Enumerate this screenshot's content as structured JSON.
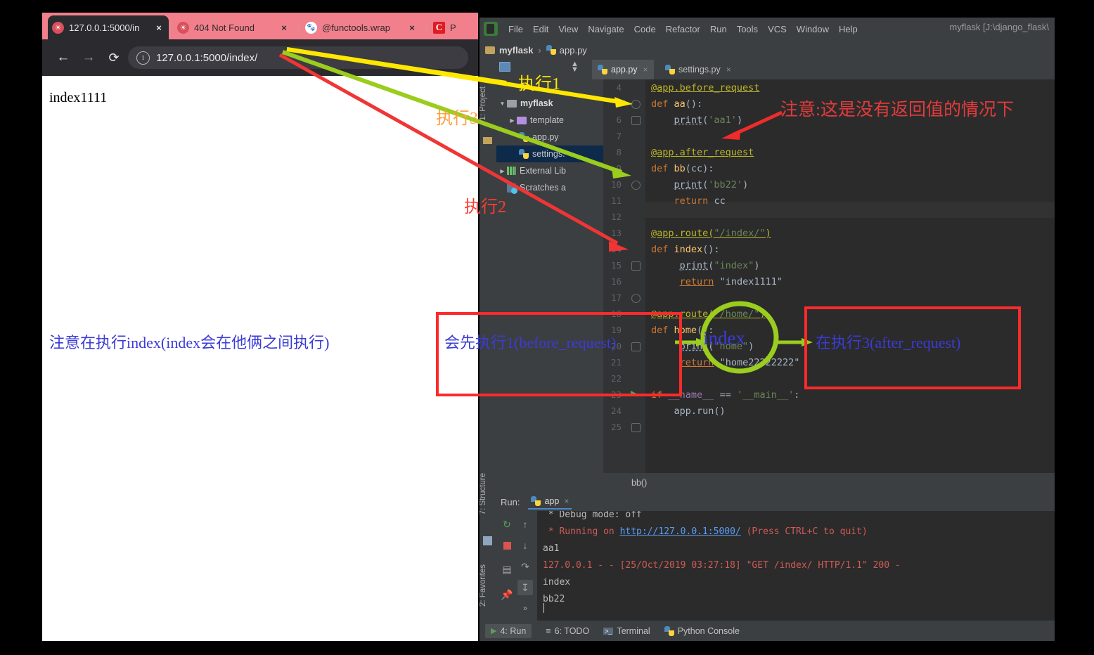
{
  "browser": {
    "tabs": [
      {
        "title": "127.0.0.1:5000/in",
        "favicon": "globe-icon",
        "active": true
      },
      {
        "title": "404 Not Found",
        "favicon": "globe-icon",
        "active": false
      },
      {
        "title": "@functools.wrap",
        "favicon": "baidu-icon",
        "active": false
      },
      {
        "title": "P",
        "favicon": "c-icon",
        "active": false
      }
    ],
    "close_label": "×",
    "nav": {
      "back": "←",
      "forward": "→",
      "reload": "⟳",
      "info": "i"
    },
    "url": "127.0.0.1:5000/index/",
    "page_text": "index1111"
  },
  "pycharm": {
    "menu": [
      "File",
      "Edit",
      "View",
      "Navigate",
      "Code",
      "Refactor",
      "Run",
      "Tools",
      "VCS",
      "Window",
      "Help"
    ],
    "window_title": "myflask [J:\\django_flask\\",
    "breadcrumb": {
      "project": "myflask",
      "separator": "›",
      "file": "app.py"
    },
    "toolwindows_left": [
      "1: Project",
      "7: Structure",
      "2: Favorites"
    ],
    "project": {
      "header": "Project",
      "tree": [
        {
          "label": "myflask",
          "type": "folder-root",
          "expanded": true,
          "indent": 0
        },
        {
          "label": "template",
          "type": "folder",
          "expanded": false,
          "indent": 1
        },
        {
          "label": "app.py",
          "type": "python",
          "indent": 1
        },
        {
          "label": "settings.",
          "type": "python",
          "indent": 1,
          "selected": true
        },
        {
          "label": "External Lib",
          "type": "library",
          "expanded": false,
          "indent": 0
        },
        {
          "label": "Scratches a",
          "type": "scratches",
          "indent": 0
        }
      ]
    },
    "editor_tabs": [
      {
        "label": "app.py",
        "active": true,
        "close": "×"
      },
      {
        "label": "settings.py",
        "active": false,
        "close": "×"
      }
    ],
    "code": {
      "first_line_number": 4,
      "lines": [
        {
          "n": 4,
          "text": "@app.before_request"
        },
        {
          "n": 5,
          "text": "def aa():"
        },
        {
          "n": 6,
          "text": "    print('aa1')"
        },
        {
          "n": 7,
          "text": ""
        },
        {
          "n": 8,
          "text": "@app.after_request"
        },
        {
          "n": 9,
          "text": "def bb(cc):"
        },
        {
          "n": 10,
          "text": "    print('bb22')"
        },
        {
          "n": 11,
          "text": "    return cc"
        },
        {
          "n": 12,
          "text": ""
        },
        {
          "n": 13,
          "text": "@app.route(\"/index/\")"
        },
        {
          "n": 14,
          "text": "def index():"
        },
        {
          "n": 15,
          "text": "    print(\"index\")"
        },
        {
          "n": 16,
          "text": "    return \"index1111\""
        },
        {
          "n": 17,
          "text": ""
        },
        {
          "n": 18,
          "text": "@app.route(\"/home/\")"
        },
        {
          "n": 19,
          "text": "def home():"
        },
        {
          "n": 20,
          "text": "    print(\"home\")"
        },
        {
          "n": 21,
          "text": "    return \"home22222222\""
        },
        {
          "n": 22,
          "text": ""
        },
        {
          "n": 23,
          "text": "if __name__ == '__main__':"
        },
        {
          "n": 24,
          "text": "    app.run()"
        },
        {
          "n": 25,
          "text": ""
        }
      ],
      "breadcrumb_bottom": "bb()"
    },
    "run": {
      "label": "Run:",
      "tab": "app",
      "tab_close": "×",
      "toolbar_icons": [
        "rerun-icon",
        "stop-icon",
        "print-icon",
        "pin-icon",
        "scroll-up-icon",
        "scroll-down-icon",
        "soft-wrap-icon",
        "scroll-to-end-icon",
        "more-icon"
      ],
      "console": [
        {
          "text": " * Debug mode: off",
          "type": "normal"
        },
        {
          "text": " * Running on ",
          "link": "http://127.0.0.1:5000/",
          "tail": " (Press CTRL+C to quit)",
          "type": "err"
        },
        {
          "text": "aa1",
          "type": "normal"
        },
        {
          "text": "127.0.0.1 - - [25/Oct/2019 03:27:18] \"GET /index/ HTTP/1.1\" 200 -",
          "type": "err"
        },
        {
          "text": "index",
          "type": "normal"
        },
        {
          "text": "bb22",
          "type": "normal"
        }
      ]
    },
    "statusbar": [
      "4: Run",
      "6: TODO",
      "Terminal",
      "Python Console"
    ],
    "status_run_prefix": "▶",
    "bottom_number": "12"
  },
  "annotations": {
    "step1": {
      "text": "执行1",
      "color": "#ffe800"
    },
    "step3_top": {
      "text": "执行3",
      "color": "#ff9f40"
    },
    "step2": {
      "text": "执行2",
      "color": "#ff3b30"
    },
    "note_red": {
      "text": "注意:这是没有返回值的情况下",
      "color": "#e23b3b"
    },
    "note_blue_left": {
      "text": "注意在执行index(index会在他俩之间执行)",
      "color": "#3b3bd6"
    },
    "box1_text": {
      "text": "会先执行1(before_request)",
      "color": "#3b3bd6"
    },
    "circle_text": {
      "text": "index",
      "color": "#3b3bd6"
    },
    "box2_text": {
      "text": "在执行3(after_request)",
      "color": "#3b3bd6"
    },
    "colors": {
      "yellow": "#ffe800",
      "green": "#9acd1e",
      "red": "#fb2b2b",
      "blue": "#3b3bd6",
      "orange": "#ff9f40"
    }
  }
}
